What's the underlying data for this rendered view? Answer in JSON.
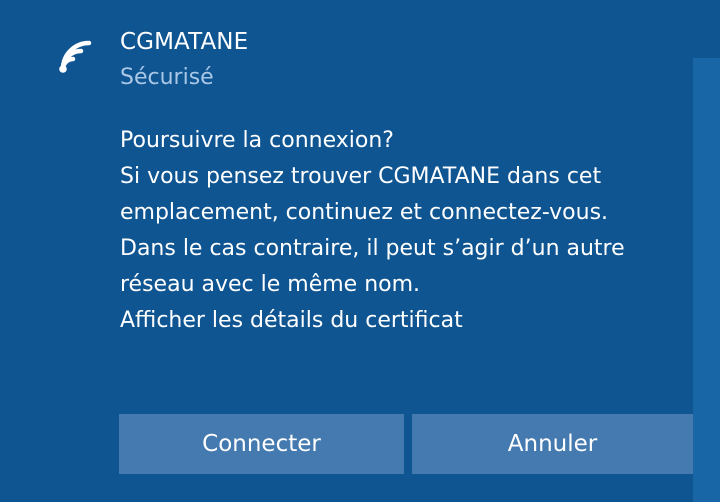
{
  "network": {
    "name": "CGMATANE",
    "status": "Sécurisé",
    "icon": "wifi-icon"
  },
  "message": {
    "question": "Poursuivre la connexion?",
    "lines": [
      "Si vous pensez trouver CGMATANE dans cet",
      "emplacement, continuez et connectez-vous.",
      "Dans le cas contraire, il peut s’agir d’un autre",
      "réseau avec le même nom."
    ],
    "certificate_link": "Afficher les détails du certificat"
  },
  "buttons": {
    "connect_label": "Connecter",
    "cancel_label": "Annuler"
  },
  "colors": {
    "background": "#0f5592",
    "button": "#447ab0",
    "secondary_text": "#a9c7e6"
  }
}
